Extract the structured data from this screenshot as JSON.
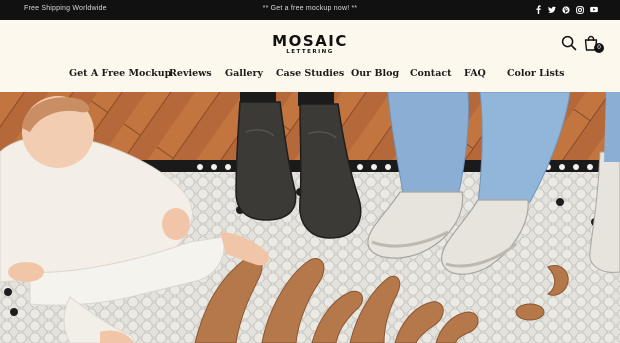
{
  "announcement": {
    "left": "Free Shipping Worldwide",
    "center": "** Get a free mockup now! **",
    "social_icons": [
      "facebook-icon",
      "twitter-icon",
      "pinterest-icon",
      "instagram-icon",
      "youtube-icon"
    ]
  },
  "header": {
    "logo_word": "MOSAIC",
    "logo_sub": "LETTERING",
    "cart_count": "0"
  },
  "nav": {
    "items": [
      "Get A Free Mockup",
      "Reviews",
      "Gallery",
      "Case Studies",
      "Our Blog",
      "Contact",
      "FAQ",
      "Color Lists"
    ]
  },
  "colors": {
    "page_bg": "#fcf8ee",
    "topbar_bg": "#111111",
    "text": "#1b1b1b",
    "floor_wood": "#b86a3a",
    "tile": "#ecebe6",
    "lettering": "#b5784a"
  }
}
